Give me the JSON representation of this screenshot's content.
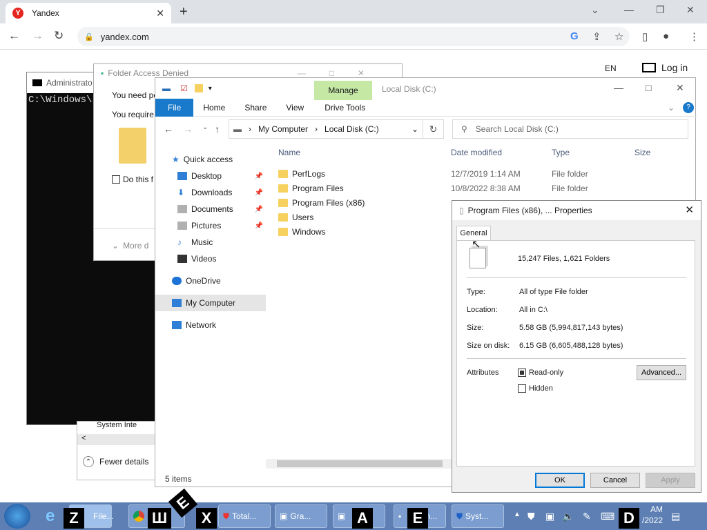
{
  "browser": {
    "tab_title": "Yandex",
    "tab_icon": "yandex-icon",
    "url": "yandex.com",
    "new_tab": "+"
  },
  "page": {
    "lang": "EN",
    "login": "Log in"
  },
  "cmd": {
    "title": "Administrato",
    "text": "C:\\Windows\\s"
  },
  "folder_access": {
    "title": "Folder Access Denied",
    "line1": "You need pe",
    "line2": "You require",
    "checkbox_label": "Do this f",
    "more": "More d"
  },
  "task_manager": {
    "item": "System Inte",
    "fewer": "Fewer details"
  },
  "explorer": {
    "title": "Local Disk (C:)",
    "manage": "Manage",
    "ribbon_tabs": [
      "File",
      "Home",
      "Share",
      "View",
      "Drive Tools"
    ],
    "breadcrumb": [
      "My Computer",
      "Local Disk (C:)"
    ],
    "search_placeholder": "Search Local Disk (C:)",
    "nav": {
      "quick_access": "Quick access",
      "items": [
        "Desktop",
        "Downloads",
        "Documents",
        "Pictures",
        "Music",
        "Videos"
      ],
      "onedrive": "OneDrive",
      "my_computer": "My Computer",
      "network": "Network"
    },
    "columns": [
      "Name",
      "Date modified",
      "Type",
      "Size"
    ],
    "files": [
      {
        "name": "PerfLogs",
        "date": "12/7/2019 1:14 AM",
        "type": "File folder"
      },
      {
        "name": "Program Files",
        "date": "10/8/2022 8:38 AM",
        "type": "File folder"
      },
      {
        "name": "Program Files (x86)",
        "date": "",
        "type": ""
      },
      {
        "name": "Users",
        "date": "",
        "type": ""
      },
      {
        "name": "Windows",
        "date": "",
        "type": ""
      }
    ],
    "status": "5 items"
  },
  "properties": {
    "title": "Program Files (x86), ... Properties",
    "tab": "General",
    "summary": "15,247 Files, 1,621 Folders",
    "type_label": "Type:",
    "type_value": "All of type File folder",
    "location_label": "Location:",
    "location_value": "All in C:\\",
    "size_label": "Size:",
    "size_value": "5.58 GB (5,994,817,143 bytes)",
    "sod_label": "Size on disk:",
    "sod_value": "6.15 GB (6,605,488,128 bytes)",
    "attributes_label": "Attributes",
    "readonly": "Read-only",
    "hidden": "Hidden",
    "advanced": "Advanced...",
    "ok": "OK",
    "cancel": "Cancel",
    "apply": "Apply"
  },
  "taskbar": {
    "buttons": [
      "File...",
      "Total...",
      "Gra...",
      "m...",
      "Syst..."
    ],
    "overlays": [
      "Z",
      "Ш",
      "E",
      "X",
      "A",
      "E",
      "D"
    ],
    "clock_time": "AM",
    "clock_date": "/2022"
  }
}
